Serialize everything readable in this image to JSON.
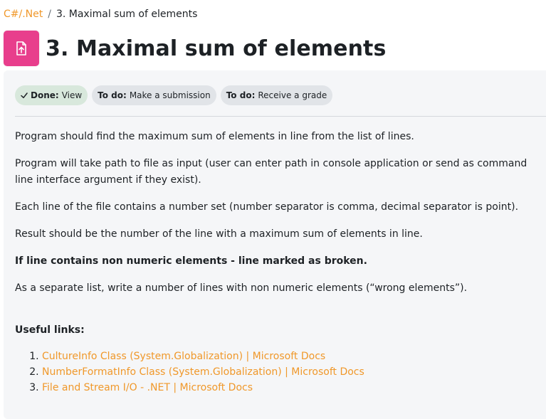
{
  "breadcrumb": {
    "parent": "C#/.Net",
    "separator": "/",
    "current": "3. Maximal sum of elements"
  },
  "header": {
    "icon": "assignment-upload-icon",
    "icon_color": "#e83e8c",
    "title": "3. Maximal sum of elements"
  },
  "completion": {
    "done": {
      "prefix": "Done:",
      "label": "View",
      "icon": "check-icon",
      "color": "#d8e8dc"
    },
    "todo_submission": {
      "prefix": "To do:",
      "label": "Make a submission"
    },
    "todo_grade": {
      "prefix": "To do:",
      "label": "Receive a grade"
    }
  },
  "description": {
    "p1": "Program should find the maximum sum of elements in line from the list of lines.",
    "p2": "Program will take path to file as input (user can enter path in console application or send as command line interface argument if they exist).",
    "p3": "Each line of the file contains a number set (number separator is comma, decimal separator is point).",
    "p4": "Result should be the number of the line with a maximum sum of elements in line.",
    "p5_bold": "If line contains non numeric elements - line marked as broken.",
    "p6": "As a separate list, write a number of lines with non numeric elements (“wrong elements”).",
    "links_title": "Useful links:",
    "links": [
      "CultureInfo Class (System.Globalization) | Microsoft Docs",
      "NumberFormatInfo Class (System.Globalization) | Microsoft Docs",
      "File and Stream I/O - .NET | Microsoft Docs"
    ]
  },
  "colors": {
    "link": "#f0982a",
    "panel_bg": "#f5f6f8"
  }
}
